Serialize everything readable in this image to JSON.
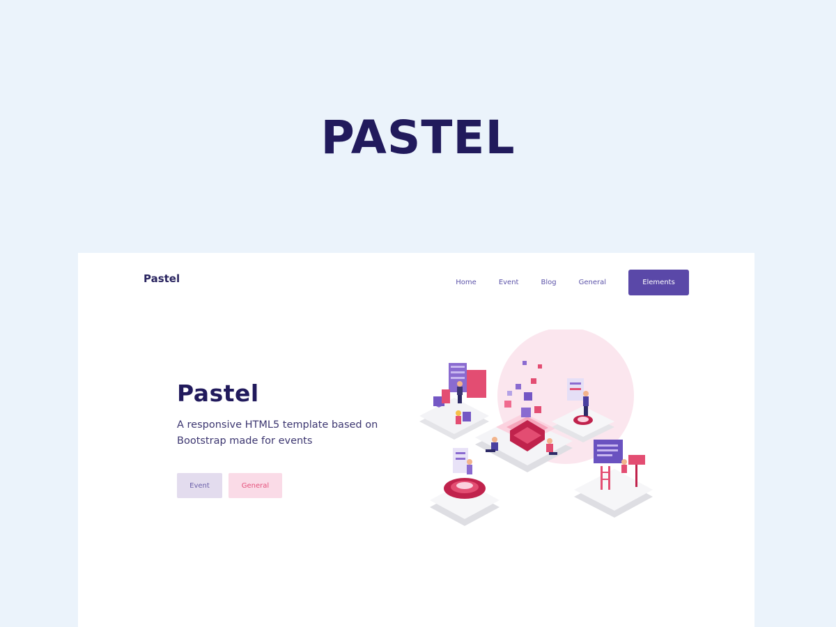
{
  "banner": {
    "title": "PASTEL"
  },
  "site": {
    "logo": "Pastel",
    "nav": [
      {
        "label": "Home"
      },
      {
        "label": "Event"
      },
      {
        "label": "Blog"
      },
      {
        "label": "General"
      }
    ],
    "nav_cta": "Elements"
  },
  "hero": {
    "title": "Pastel",
    "subtitle": "A responsive HTML5 template based on Bootstrap made for events",
    "buttons": [
      {
        "label": "Event"
      },
      {
        "label": "General"
      }
    ]
  },
  "colors": {
    "background": "#ebf3fb",
    "navy": "#211a5c",
    "purple": "#5a48a8",
    "pink": "#e4507a",
    "lavender": "#e3dcee",
    "blush": "#fadbe7"
  }
}
